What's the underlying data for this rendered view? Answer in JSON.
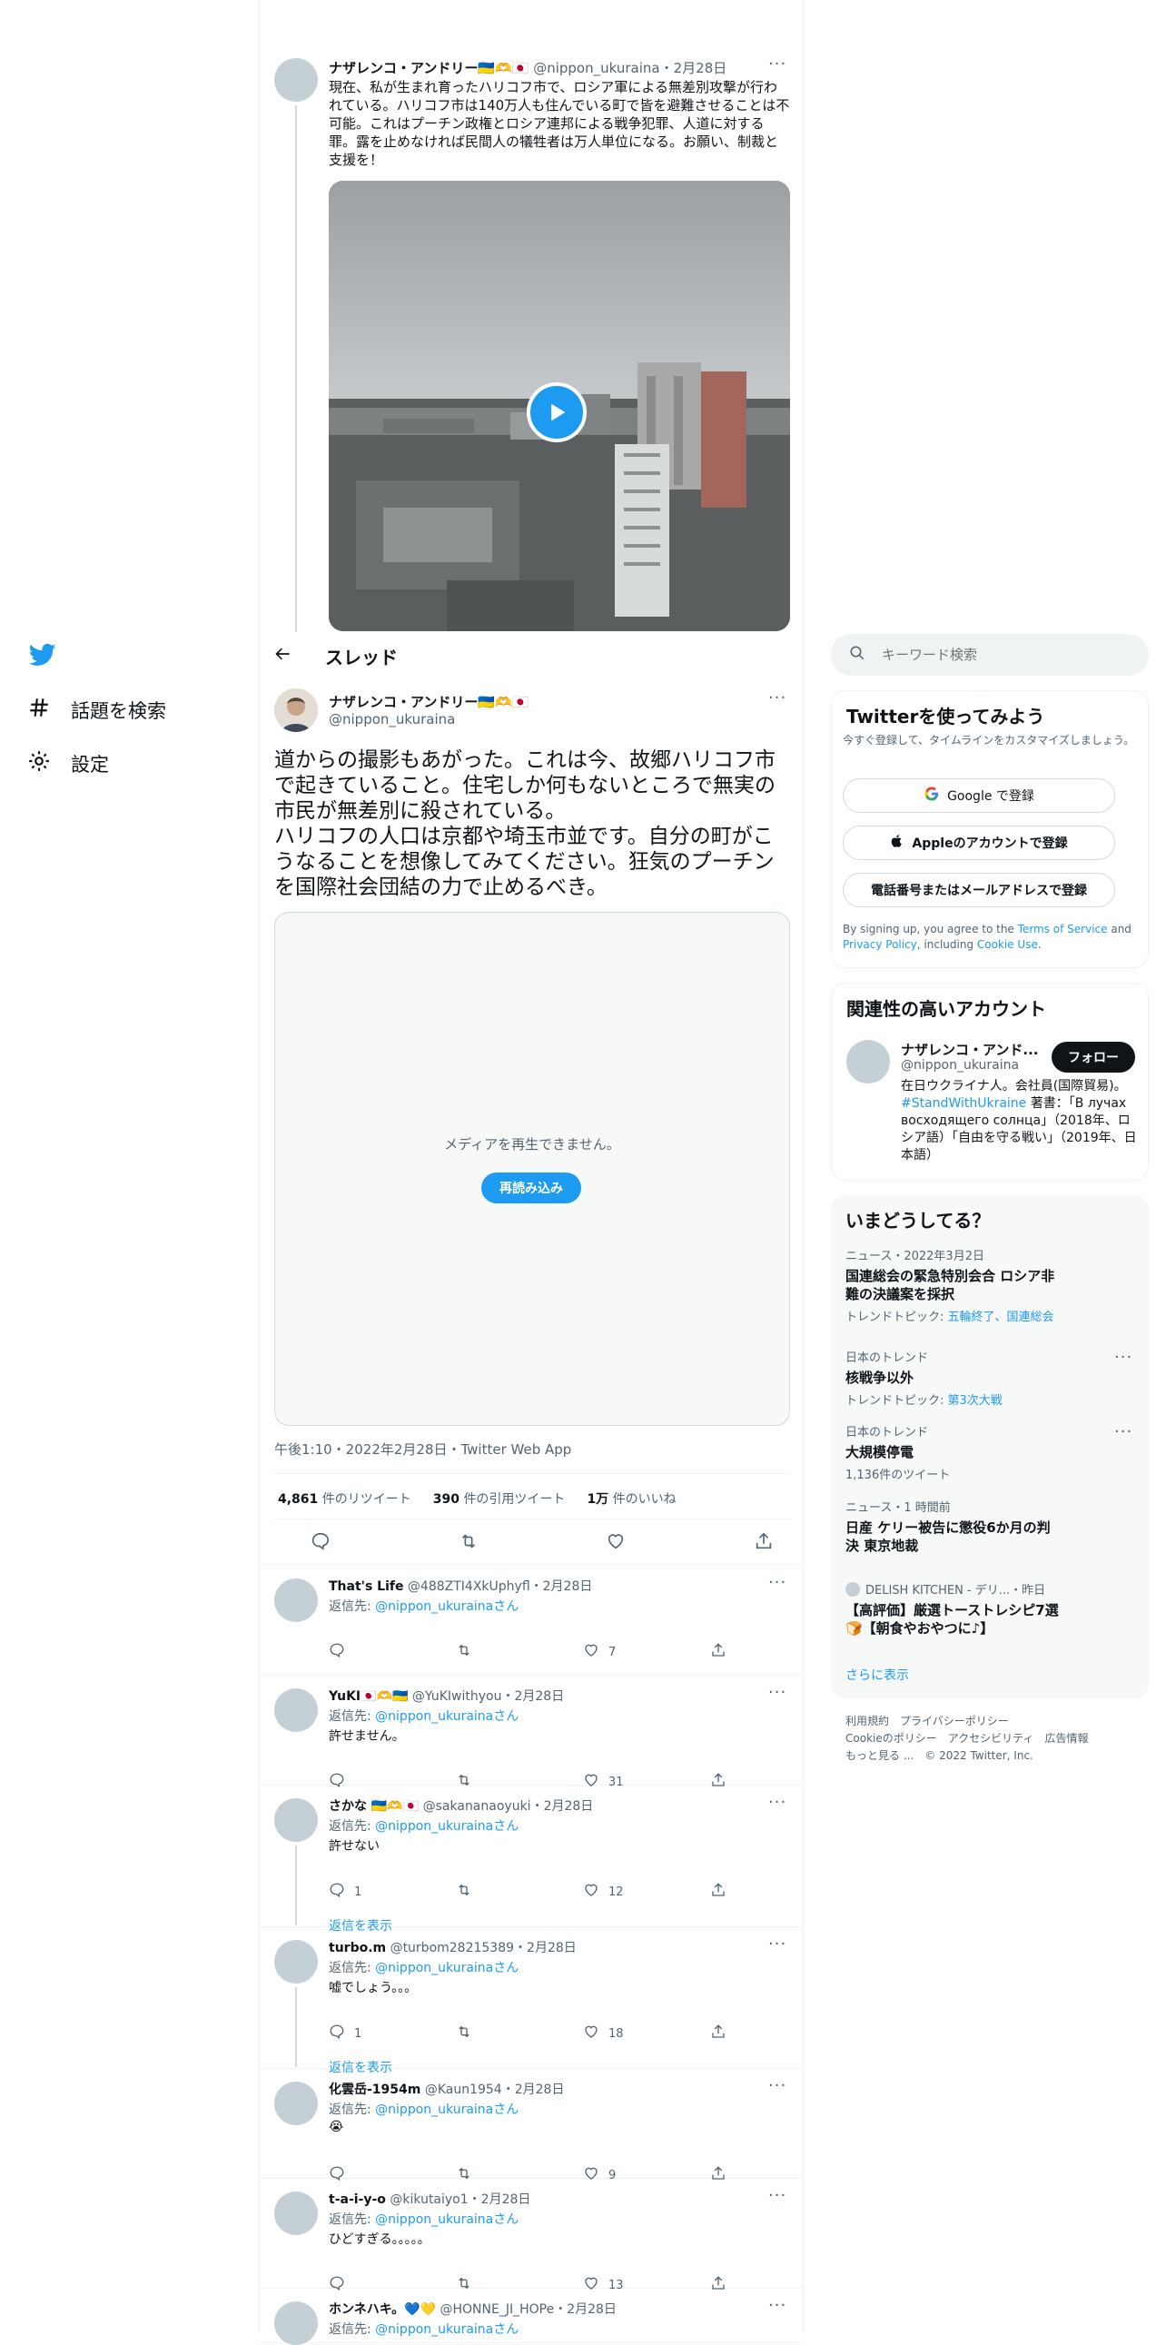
{
  "nav": {
    "explore": "話題を検索",
    "settings": "設定"
  },
  "parent_tweet": {
    "name": "ナザレンコ・アンドリー🇺🇦🫶🇯🇵",
    "handle": "@nippon_ukuraina",
    "date": "2月28日",
    "text": "現在、私が生まれ育ったハリコフ市で、ロシア軍による無差別攻撃が行われている。ハリコフ市は140万人も住んでいる町で皆を避難させることは不可能。これはプーチン政権とロシア連邦による戦争犯罪、人道に対する罪。露を止めなければ民間人の犠牲者は万人単位になる。お願い、制裁と支援を！"
  },
  "header": {
    "title": "スレッド"
  },
  "main_tweet": {
    "name": "ナザレンコ・アンドリー🇺🇦🫶🇯🇵",
    "handle": "@nippon_ukuraina",
    "text_line1": "道からの撮影もあがった。これは今、故郷ハリコフ市で起きていること。住宅しか何もないところで無実の市民が無差別に殺されている。",
    "text_line2": "ハリコフの人口は京都や埼玉市並です。自分の町がこうなることを想像してみてください。狂気のプーチンを国際社会団結の力で止めるべき。",
    "media_error": "メディアを再生できません。",
    "reload_label": "再読み込み",
    "timestamp": "午後1:10・2022年2月28日・Twitter Web App",
    "retweets_count": "4,861",
    "retweets_label": "件のリツイート",
    "quotes_count": "390",
    "quotes_label": "件の引用ツイート",
    "likes_count": "1万",
    "likes_label": "件のいいね"
  },
  "replies": [
    {
      "name": "That's Life",
      "handle": "@488ZTI4XkUphyfl",
      "date": "2月28日",
      "reply_to_prefix": "返信先: ",
      "reply_to": "@nippon_ukurainaさん",
      "text": "",
      "replies": "",
      "likes": "7",
      "show_replies": ""
    },
    {
      "name": "YuKI🇯🇵🫶🇺🇦",
      "handle": "@YuKIwithyou",
      "date": "2月28日",
      "reply_to_prefix": "返信先: ",
      "reply_to": "@nippon_ukurainaさん",
      "text": "許せません。",
      "replies": "",
      "likes": "31",
      "show_replies": ""
    },
    {
      "name": "さかな 🇺🇦🫶🇯🇵",
      "handle": "@sakananaoyuki",
      "date": "2月28日",
      "reply_to_prefix": "返信先: ",
      "reply_to": "@nippon_ukurainaさん",
      "text": "許せない",
      "replies": "1",
      "likes": "12",
      "show_replies": "返信を表示"
    },
    {
      "name": "turbo.m",
      "handle": "@turbom28215389",
      "date": "2月28日",
      "reply_to_prefix": "返信先: ",
      "reply_to": "@nippon_ukurainaさん",
      "text": "嘘でしょう。。。",
      "replies": "1",
      "likes": "18",
      "show_replies": "返信を表示"
    },
    {
      "name": "化雲岳-1954m",
      "handle": "@Kaun1954",
      "date": "2月28日",
      "reply_to_prefix": "返信先: ",
      "reply_to": "@nippon_ukurainaさん",
      "text": "😭",
      "replies": "",
      "likes": "9",
      "show_replies": ""
    },
    {
      "name": "t-a-i-y-o",
      "handle": "@kikutaiyo1",
      "date": "2月28日",
      "reply_to_prefix": "返信先: ",
      "reply_to": "@nippon_ukurainaさん",
      "text": "ひどすぎる。。。。。",
      "replies": "",
      "likes": "13",
      "show_replies": ""
    },
    {
      "name": "ホンネハキ。💙💛",
      "handle": "@HONNE_JI_HOPe",
      "date": "2月28日",
      "reply_to_prefix": "返信先: ",
      "reply_to": "@nippon_ukurainaさん",
      "text": "",
      "replies": "",
      "likes": "",
      "show_replies": ""
    }
  ],
  "search": {
    "placeholder": "キーワード検索"
  },
  "signup": {
    "title": "Twitterを使ってみよう",
    "subtitle": "今すぐ登録して、タイムラインをカスタマイズしましょう。",
    "google_label": "Google で登録",
    "apple_label": "Appleのアカウントで登録",
    "phone_label": "電話番号またはメールアドレスで登録",
    "terms_prefix": "By signing up, you agree to the ",
    "terms_link": "Terms of Service",
    "terms_and": " and ",
    "privacy_link": "Privacy Policy",
    "terms_including": ", including ",
    "cookie_link": "Cookie Use",
    "terms_end": "."
  },
  "related": {
    "title": "関連性の高いアカウント",
    "name": "ナザレンコ・アンド...",
    "handle": "@nippon_ukuraina",
    "follow_label": "フォロー",
    "bio_part1": "在日ウクライナ人。会社員(国際貿易)。",
    "bio_hashtag": "#StandWithUkraine",
    "bio_part2": " 著書：「В лучах восходящего солнца」（2018年、ロシア語）「自由を守る戦い」（2019年、日本語）"
  },
  "trends": {
    "title": "いまどうしてる？",
    "items": [
      {
        "meta": "ニュース・2022年3月2日",
        "title": "国連総会の緊急特別会合 ロシア非難の決議案を採択",
        "sub_prefix": "トレンドトピック: ",
        "sub_link": "五輪終了、国連総会"
      },
      {
        "meta": "日本のトレンド",
        "title": "核戦争以外",
        "sub_prefix": "トレンドトピック: ",
        "sub_link": "第3次大戦"
      },
      {
        "meta": "日本のトレンド",
        "title": "大規模停電",
        "sub_prefix": "1,136件のツイート",
        "sub_link": ""
      },
      {
        "meta": "ニュース・1 時間前",
        "title": "日産 ケリー被告に懲役6か月の判決 東京地裁",
        "sub_prefix": "",
        "sub_link": ""
      },
      {
        "meta": "DELISH KITCHEN - デリ...・昨日",
        "title": "【高評価】厳選トーストレシピ7選🍞【朝食やおやつに♪】",
        "sub_prefix": "",
        "sub_link": ""
      }
    ],
    "show_more": "さらに表示"
  },
  "footer": {
    "terms": "利用規約",
    "privacy": "プライバシーポリシー",
    "cookie": "Cookieのポリシー",
    "accessibility": "アクセシビリティ",
    "ads": "広告情報",
    "more": "もっと見る ...",
    "copyright": "© 2022 Twitter, Inc."
  },
  "colors": {
    "accent": "#1d9bf0",
    "text": "#0f1419",
    "muted": "#536471"
  }
}
